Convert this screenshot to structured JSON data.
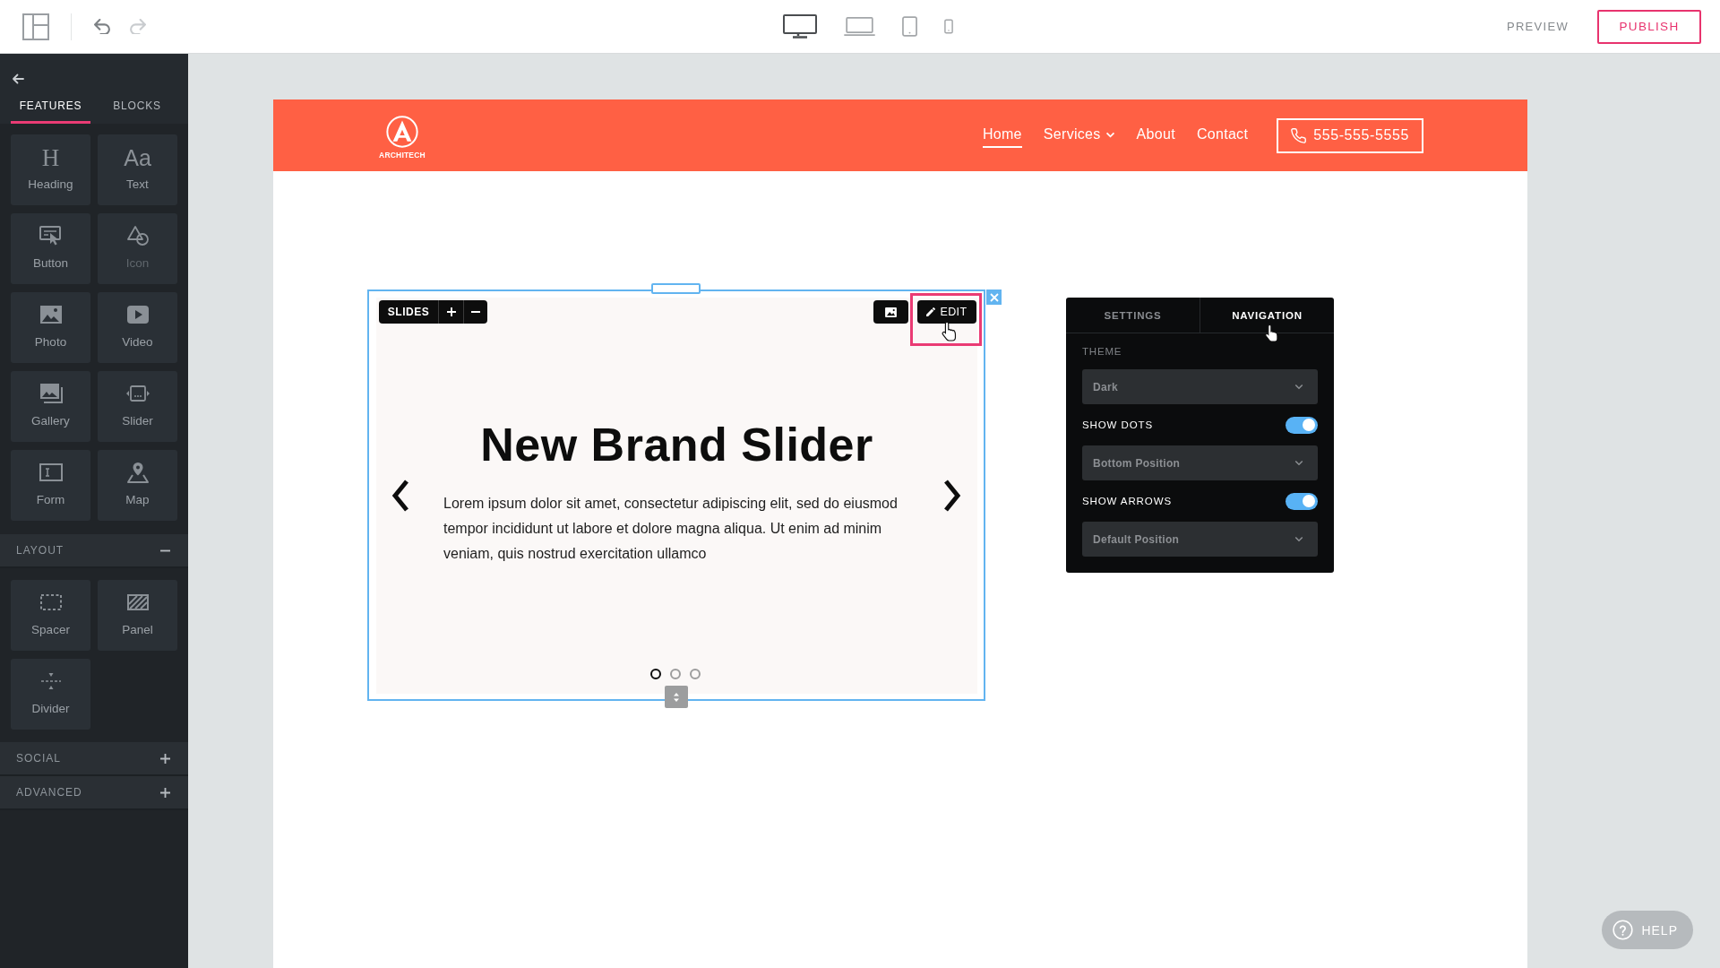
{
  "toolbar": {
    "history": [
      {
        "kind": "undo",
        "disabled": false
      },
      {
        "kind": "redo",
        "disabled": true
      }
    ],
    "devices": [
      {
        "kind": "desktop",
        "selected": true
      },
      {
        "kind": "laptop",
        "selected": false
      },
      {
        "kind": "tablet",
        "selected": false
      },
      {
        "kind": "phone",
        "selected": false
      }
    ],
    "preview": "PREVIEW",
    "publish": "PUBLISH"
  },
  "sidebar": {
    "tabs": [
      {
        "label": "FEATURES",
        "selected": true
      },
      {
        "label": "BLOCKS",
        "selected": false
      }
    ],
    "features": [
      {
        "kind": "heading",
        "glyph": "H",
        "label": "Heading",
        "disabled": false
      },
      {
        "kind": "text",
        "glyph": "Aa",
        "label": "Text",
        "disabled": false
      },
      {
        "kind": "button",
        "label": "Button",
        "disabled": false
      },
      {
        "kind": "icon",
        "label": "Icon",
        "disabled": true
      },
      {
        "kind": "photo",
        "label": "Photo",
        "disabled": false
      },
      {
        "kind": "video",
        "label": "Video",
        "disabled": false
      },
      {
        "kind": "gallery",
        "label": "Gallery",
        "disabled": false
      },
      {
        "kind": "slider",
        "label": "Slider",
        "disabled": false
      },
      {
        "kind": "form",
        "label": "Form",
        "disabled": false
      },
      {
        "kind": "map",
        "label": "Map",
        "disabled": false
      }
    ],
    "sections": [
      {
        "title": "LAYOUT",
        "expanded": true,
        "items": [
          {
            "kind": "spacer",
            "label": "Spacer",
            "disabled": false
          },
          {
            "kind": "panel",
            "label": "Panel",
            "disabled": false
          },
          {
            "kind": "divider",
            "label": "Divider",
            "disabled": false
          }
        ]
      },
      {
        "title": "SOCIAL",
        "expanded": false
      },
      {
        "title": "ADVANCED",
        "expanded": false
      }
    ]
  },
  "site_header": {
    "logo_text": "ARCHITECH",
    "nav": [
      {
        "label": "Home",
        "selected": true,
        "dropdown": false
      },
      {
        "label": "Services",
        "selected": false,
        "dropdown": true
      },
      {
        "label": "About",
        "selected": false,
        "dropdown": false
      },
      {
        "label": "Contact",
        "selected": false,
        "dropdown": false
      }
    ],
    "phone": "555-555-5555"
  },
  "slider": {
    "toolbar_label": "SLIDES",
    "edit_label": "EDIT",
    "heading": "New Brand Slider",
    "body": "Lorem ipsum dolor sit amet, consectetur adipiscing elit, sed do eiusmod tempor incididunt ut labore et dolore magna aliqua. Ut enim ad minim veniam, quis nostrud exercitation ullamco",
    "dots": [
      {
        "selected": true
      },
      {
        "selected": false
      },
      {
        "selected": false
      }
    ]
  },
  "nav_panel": {
    "tabs": [
      {
        "label": "SETTINGS",
        "selected": false
      },
      {
        "label": "NAVIGATION",
        "selected": true
      }
    ],
    "rows": [
      {
        "kind": "heading",
        "label": "THEME"
      },
      {
        "kind": "select",
        "value": "Dark"
      },
      {
        "kind": "toggle",
        "label": "SHOW DOTS",
        "on": true
      },
      {
        "kind": "select",
        "value": "Bottom Position"
      },
      {
        "kind": "toggle",
        "label": "SHOW ARROWS",
        "on": true
      },
      {
        "kind": "select",
        "value": "Default Position"
      }
    ]
  },
  "help": {
    "label": "HELP"
  }
}
